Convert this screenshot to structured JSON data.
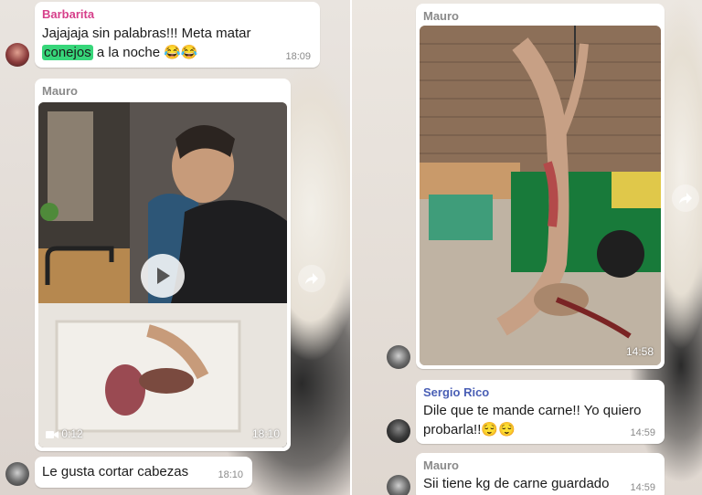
{
  "left": {
    "msg1": {
      "sender": "Barbarita",
      "sender_color": "#d63f8a",
      "text_before": "Jajajaja sin palabras!!! Meta matar",
      "highlight": "conejos",
      "text_after": " a la noche 😂😂",
      "time": "18:09"
    },
    "video": {
      "sender": "Mauro",
      "sender_color": "#8a8a8a",
      "duration": "0:12",
      "time": "18:10"
    },
    "msg3": {
      "text": "Le gusta cortar cabezas",
      "time": "18:10"
    }
  },
  "right": {
    "photo": {
      "sender": "Mauro",
      "sender_color": "#8a8a8a",
      "time": "14:58"
    },
    "msg_sergio": {
      "sender": "Sergio Rico",
      "sender_color": "#4a5fb5",
      "line1": "Dile que te mande carne!! Yo quiero",
      "line2": "probarla!!😌😌",
      "time": "14:59"
    },
    "msg_mauro": {
      "sender": "Mauro",
      "sender_color": "#8a8a8a",
      "text": "Sii tiene kg de carne guardado",
      "time": "14:59"
    }
  },
  "icons": {
    "share": "share-arrow-icon",
    "play": "play-icon",
    "video": "video-camera-icon"
  }
}
